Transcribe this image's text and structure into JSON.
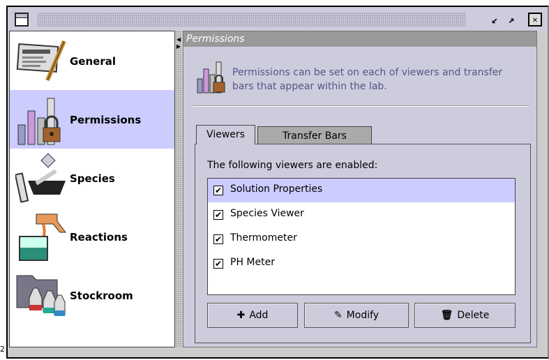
{
  "stray_label": "2",
  "window": {
    "controls": [
      "minimize-icon",
      "maximize-icon",
      "close-icon"
    ]
  },
  "categories": [
    {
      "label": "General",
      "icon": "document-pen-icon"
    },
    {
      "label": "Permissions",
      "icon": "chart-lock-icon",
      "selected": true
    },
    {
      "label": "Species",
      "icon": "mortar-pestle-icon"
    },
    {
      "label": "Reactions",
      "icon": "beaker-pour-icon"
    },
    {
      "label": "Stockroom",
      "icon": "folder-flasks-icon"
    }
  ],
  "panel": {
    "header": "Permissions",
    "description": "Permissions can be set on each of viewers and transfer bars that appear within the lab.",
    "tabs": [
      "Viewers",
      "Transfer Bars"
    ],
    "active_tab": "Viewers",
    "list_label": "The following viewers are enabled:",
    "viewers": [
      {
        "label": "Solution Properties",
        "checked": true,
        "selected": true
      },
      {
        "label": "Species Viewer",
        "checked": true
      },
      {
        "label": "Thermometer",
        "checked": true
      },
      {
        "label": "PH Meter",
        "checked": true
      }
    ],
    "buttons": {
      "add": "Add",
      "modify": "Modify",
      "delete": "Delete"
    }
  },
  "colors": {
    "selection": "#ccccff",
    "header": "#999999",
    "description": "#555588"
  }
}
